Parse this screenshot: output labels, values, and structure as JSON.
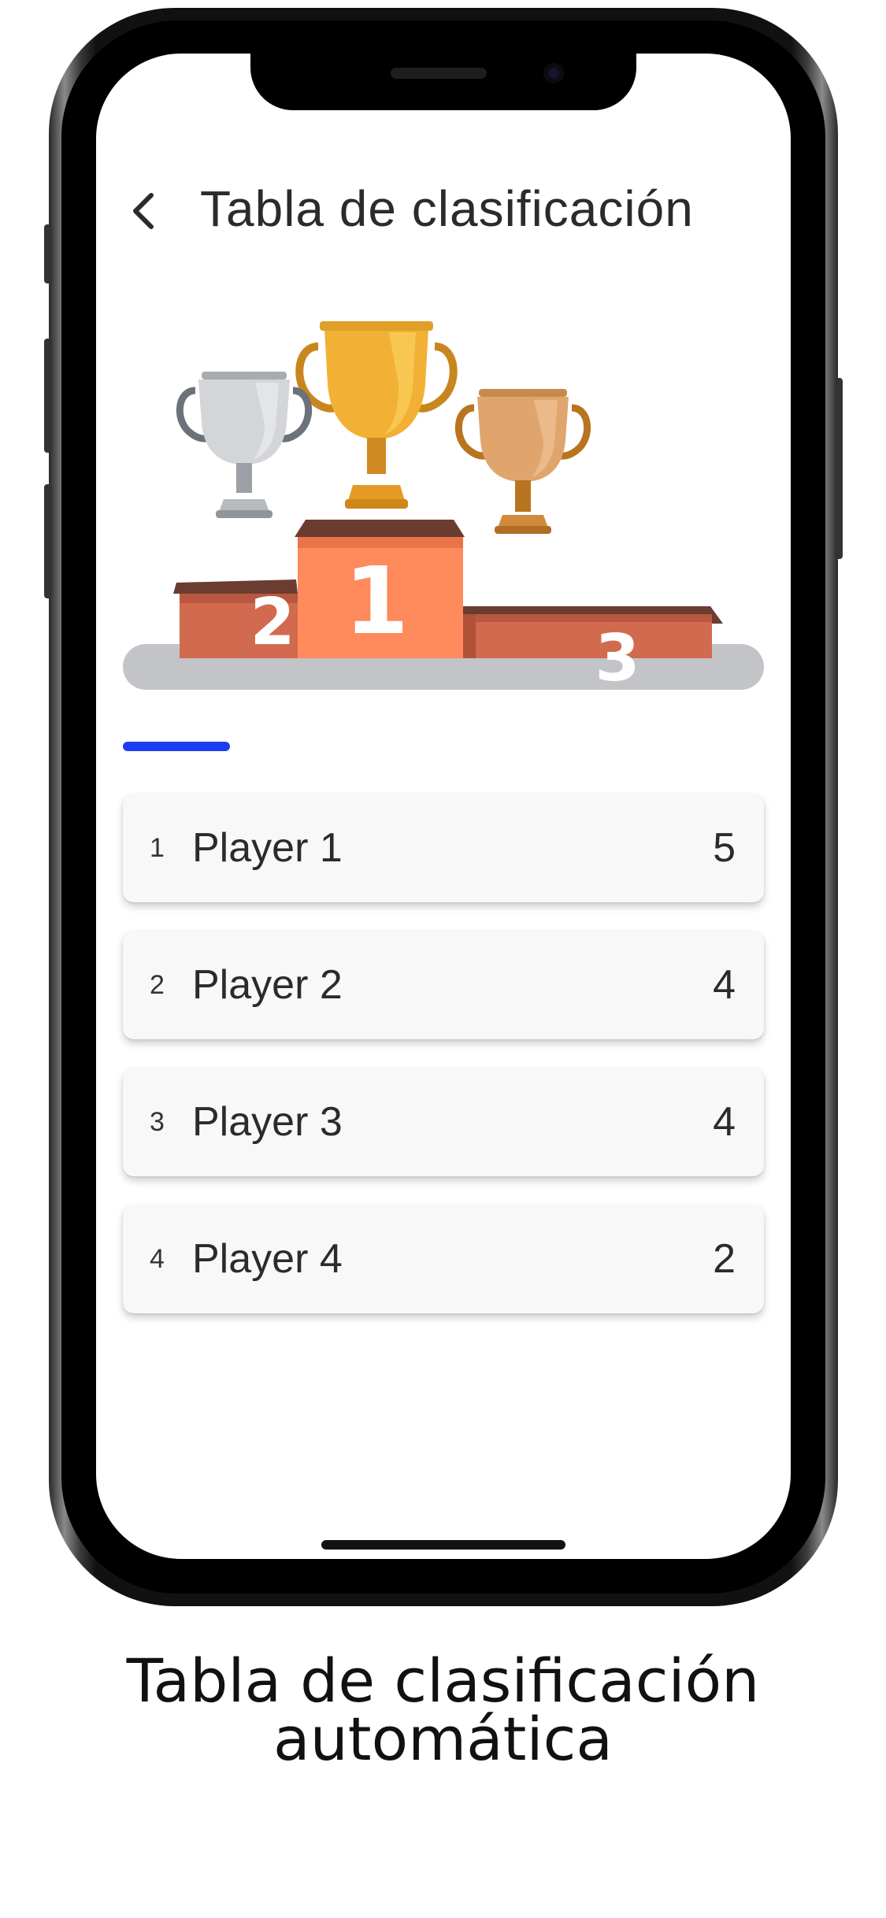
{
  "header": {
    "title": "Tabla de clasificación"
  },
  "icons": {
    "back": "chevron-left-icon"
  },
  "podium": {
    "places": [
      {
        "place": "2",
        "trophy": "silver-trophy"
      },
      {
        "place": "1",
        "trophy": "gold-trophy"
      },
      {
        "place": "3",
        "trophy": "bronze-trophy"
      }
    ]
  },
  "leaderboard": {
    "rows": [
      {
        "rank": "1",
        "name": "Player 1",
        "score": "5"
      },
      {
        "rank": "2",
        "name": "Player 2",
        "score": "4"
      },
      {
        "rank": "3",
        "name": "Player 3",
        "score": "4"
      },
      {
        "rank": "4",
        "name": "Player 4",
        "score": "2"
      }
    ]
  },
  "caption": {
    "line1": "Tabla de clasificación",
    "line2": "automática"
  },
  "colors": {
    "accent": "#1e3df0",
    "podium_first": "#ff8a5b",
    "podium_side": "#c9644b",
    "gold": "#f2b134",
    "silver": "#d4d5d8",
    "bronze": "#e0a56d"
  }
}
